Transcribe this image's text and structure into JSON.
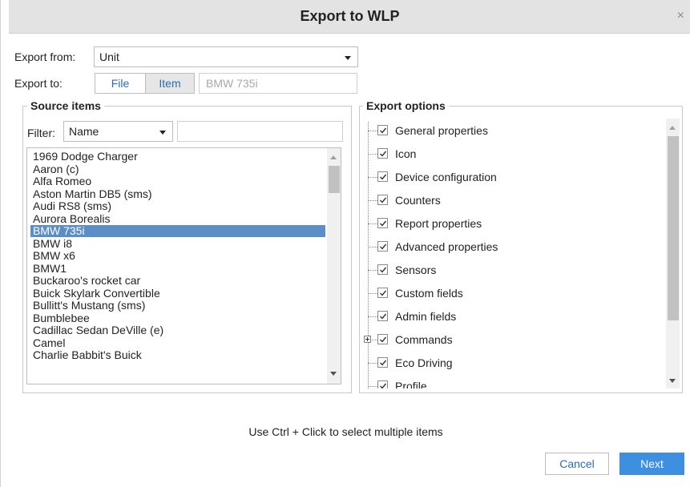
{
  "dialog": {
    "title": "Export to WLP",
    "close_glyph": "×"
  },
  "export_from": {
    "label": "Export from:",
    "selected": "Unit"
  },
  "export_to": {
    "label": "Export to:",
    "file_label": "File",
    "item_label": "Item",
    "active": "Item",
    "item_value": "BMW 735i"
  },
  "source": {
    "legend": "Source items",
    "filter_label": "Filter:",
    "filter_selected": "Name",
    "filter_text": "",
    "items": [
      "1969 Dodge Charger",
      "Aaron (c)",
      "Alfa Romeo",
      "Aston Martin DB5 (sms)",
      "Audi RS8 (sms)",
      "Aurora Borealis",
      "BMW 735i",
      "BMW i8",
      "BMW x6",
      "BMW1",
      "Buckaroo's rocket car",
      "Buick Skylark Convertible",
      "Bullitt's Mustang (sms)",
      "Bumblebee",
      "Cadillac Sedan DeVille (e)",
      "Camel",
      "Charlie Babbit's Buick"
    ],
    "selected_item": "BMW 735i"
  },
  "export_options": {
    "legend": "Export options",
    "items": [
      {
        "label": "General properties",
        "checked": true
      },
      {
        "label": "Icon",
        "checked": true
      },
      {
        "label": "Device configuration",
        "checked": true
      },
      {
        "label": "Counters",
        "checked": true
      },
      {
        "label": "Report properties",
        "checked": true
      },
      {
        "label": "Advanced properties",
        "checked": true
      },
      {
        "label": "Sensors",
        "checked": true
      },
      {
        "label": "Custom fields",
        "checked": true
      },
      {
        "label": "Admin fields",
        "checked": true
      },
      {
        "label": "Commands",
        "checked": true,
        "expandable": true
      },
      {
        "label": "Eco Driving",
        "checked": true
      },
      {
        "label": "Profile",
        "checked": true
      }
    ]
  },
  "footer": {
    "hint": "Use Ctrl + Click to select multiple items",
    "cancel_label": "Cancel",
    "next_label": "Next"
  },
  "colors": {
    "accent": "#3d8fe0",
    "selection": "#5b8dc7",
    "link": "#2a6cb8",
    "titlebar": "#e3e3e3"
  },
  "icons": {
    "close": "close-icon",
    "dropdown": "chevron-down-icon",
    "checkbox": "checkbox-checked-icon",
    "expander": "plus-expander-icon"
  }
}
